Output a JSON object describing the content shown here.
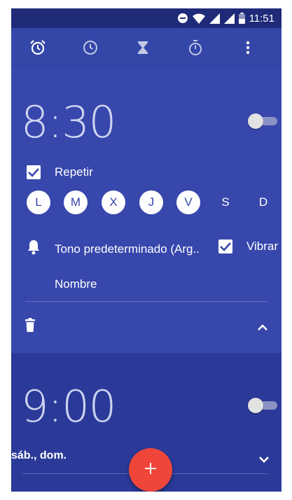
{
  "status_bar": {
    "time": "11:51"
  },
  "toolbar": {
    "tabs": [
      {
        "icon": "alarm-icon"
      },
      {
        "icon": "clock-icon"
      },
      {
        "icon": "timer-hourglass-icon"
      },
      {
        "icon": "stopwatch-icon"
      }
    ],
    "overflow_icon": "more-vert-icon"
  },
  "alarm1": {
    "time": "8:30",
    "enabled": false,
    "repeat_label": "Repetir",
    "repeat_checked": true,
    "days": [
      {
        "label": "L",
        "selected": true
      },
      {
        "label": "M",
        "selected": true
      },
      {
        "label": "X",
        "selected": true
      },
      {
        "label": "J",
        "selected": true
      },
      {
        "label": "V",
        "selected": true
      },
      {
        "label": "S",
        "selected": false
      },
      {
        "label": "D",
        "selected": false
      }
    ],
    "ringtone_label": "Tono predeterminado (Arg..",
    "vibrate_label": "Vibrar",
    "vibrate_checked": true,
    "name_label": "Nombre"
  },
  "alarm2": {
    "time": "9:00",
    "enabled": false,
    "days_summary": "sáb., dom."
  },
  "colors": {
    "background": "#2b3a99",
    "expanded_card": "#3747ac",
    "toolbar": "#3446a8",
    "status_bar": "#1f2a78",
    "fab": "#f0463a"
  },
  "fab": {
    "icon": "add-icon"
  }
}
